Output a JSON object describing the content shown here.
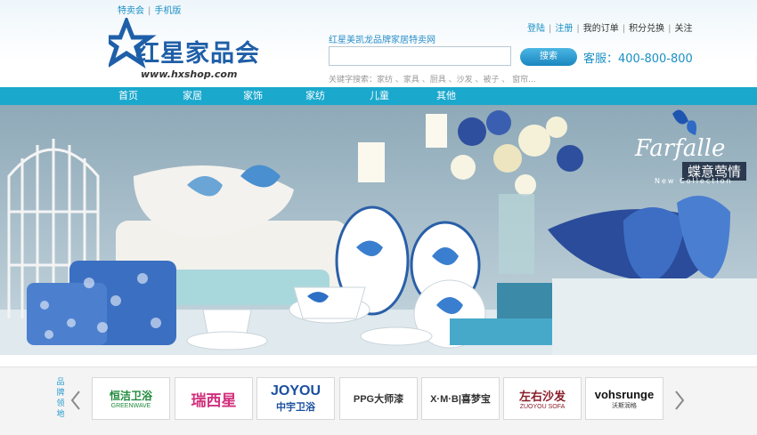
{
  "top_links": [
    "特卖会",
    "手机版"
  ],
  "logo": {
    "text": "红星家品会",
    "url": "www.hxshop.com"
  },
  "slogan": "红星美凯龙品牌家居特卖网",
  "search": {
    "button_label": "搜索",
    "placeholder": ""
  },
  "hotline": "客服：400-800-800",
  "keywords": "关键字搜索：家纺 、家具 、厨具 、沙发 、被子 、  窗帘...",
  "user_links": [
    "登陆",
    "注册",
    "我的订单",
    "积分兑换",
    "关注"
  ],
  "nav": [
    "首页",
    "家居",
    "家饰",
    "家纺",
    "儿童",
    "其他"
  ],
  "banner": {
    "title": "Farfalle",
    "subtitle": "蝶意莺情",
    "tagline": "New Collection"
  },
  "brands_title": "品牌领地",
  "brands": [
    {
      "name": "恒洁卫浴",
      "sub": "GREENWAVE"
    },
    {
      "name": "瑞西星"
    },
    {
      "name": "JOYOU",
      "sub": "中宇卫浴"
    },
    {
      "name": "PPG大师漆"
    },
    {
      "name": "X·M·B|喜梦宝"
    },
    {
      "name": "左右沙发",
      "sub": "ZUOYOU SOFA"
    },
    {
      "name": "vohsrunge",
      "sub": "沃斯润格"
    }
  ],
  "colors": {
    "nav_bg": "#1aa8cd",
    "link": "#1a8fc4",
    "logo": "#1f5fa8",
    "banner_bg": "#9fb8c6"
  }
}
